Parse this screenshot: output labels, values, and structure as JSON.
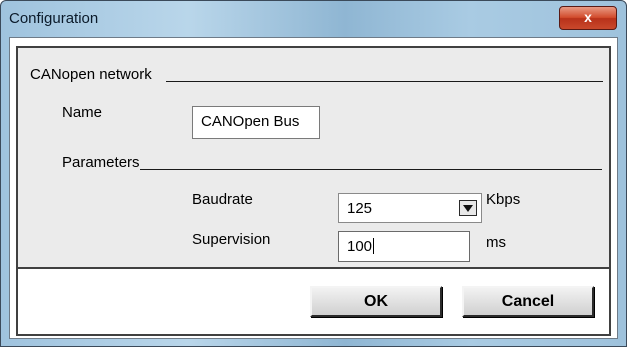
{
  "window": {
    "title": "Configuration",
    "close_label": "x"
  },
  "group": {
    "label": "CANopen network",
    "name_label": "Name",
    "name_value": "CANOpen Bus",
    "parameters_label": "Parameters",
    "baudrate_label": "Baudrate",
    "baudrate_value": "125",
    "baudrate_unit": "Kbps",
    "supervision_label": "Supervision",
    "supervision_value": "100",
    "supervision_unit": "ms"
  },
  "buttons": {
    "ok_label": "OK",
    "cancel_label": "Cancel"
  },
  "icons": {
    "dropdown": "chevron-down-icon"
  }
}
